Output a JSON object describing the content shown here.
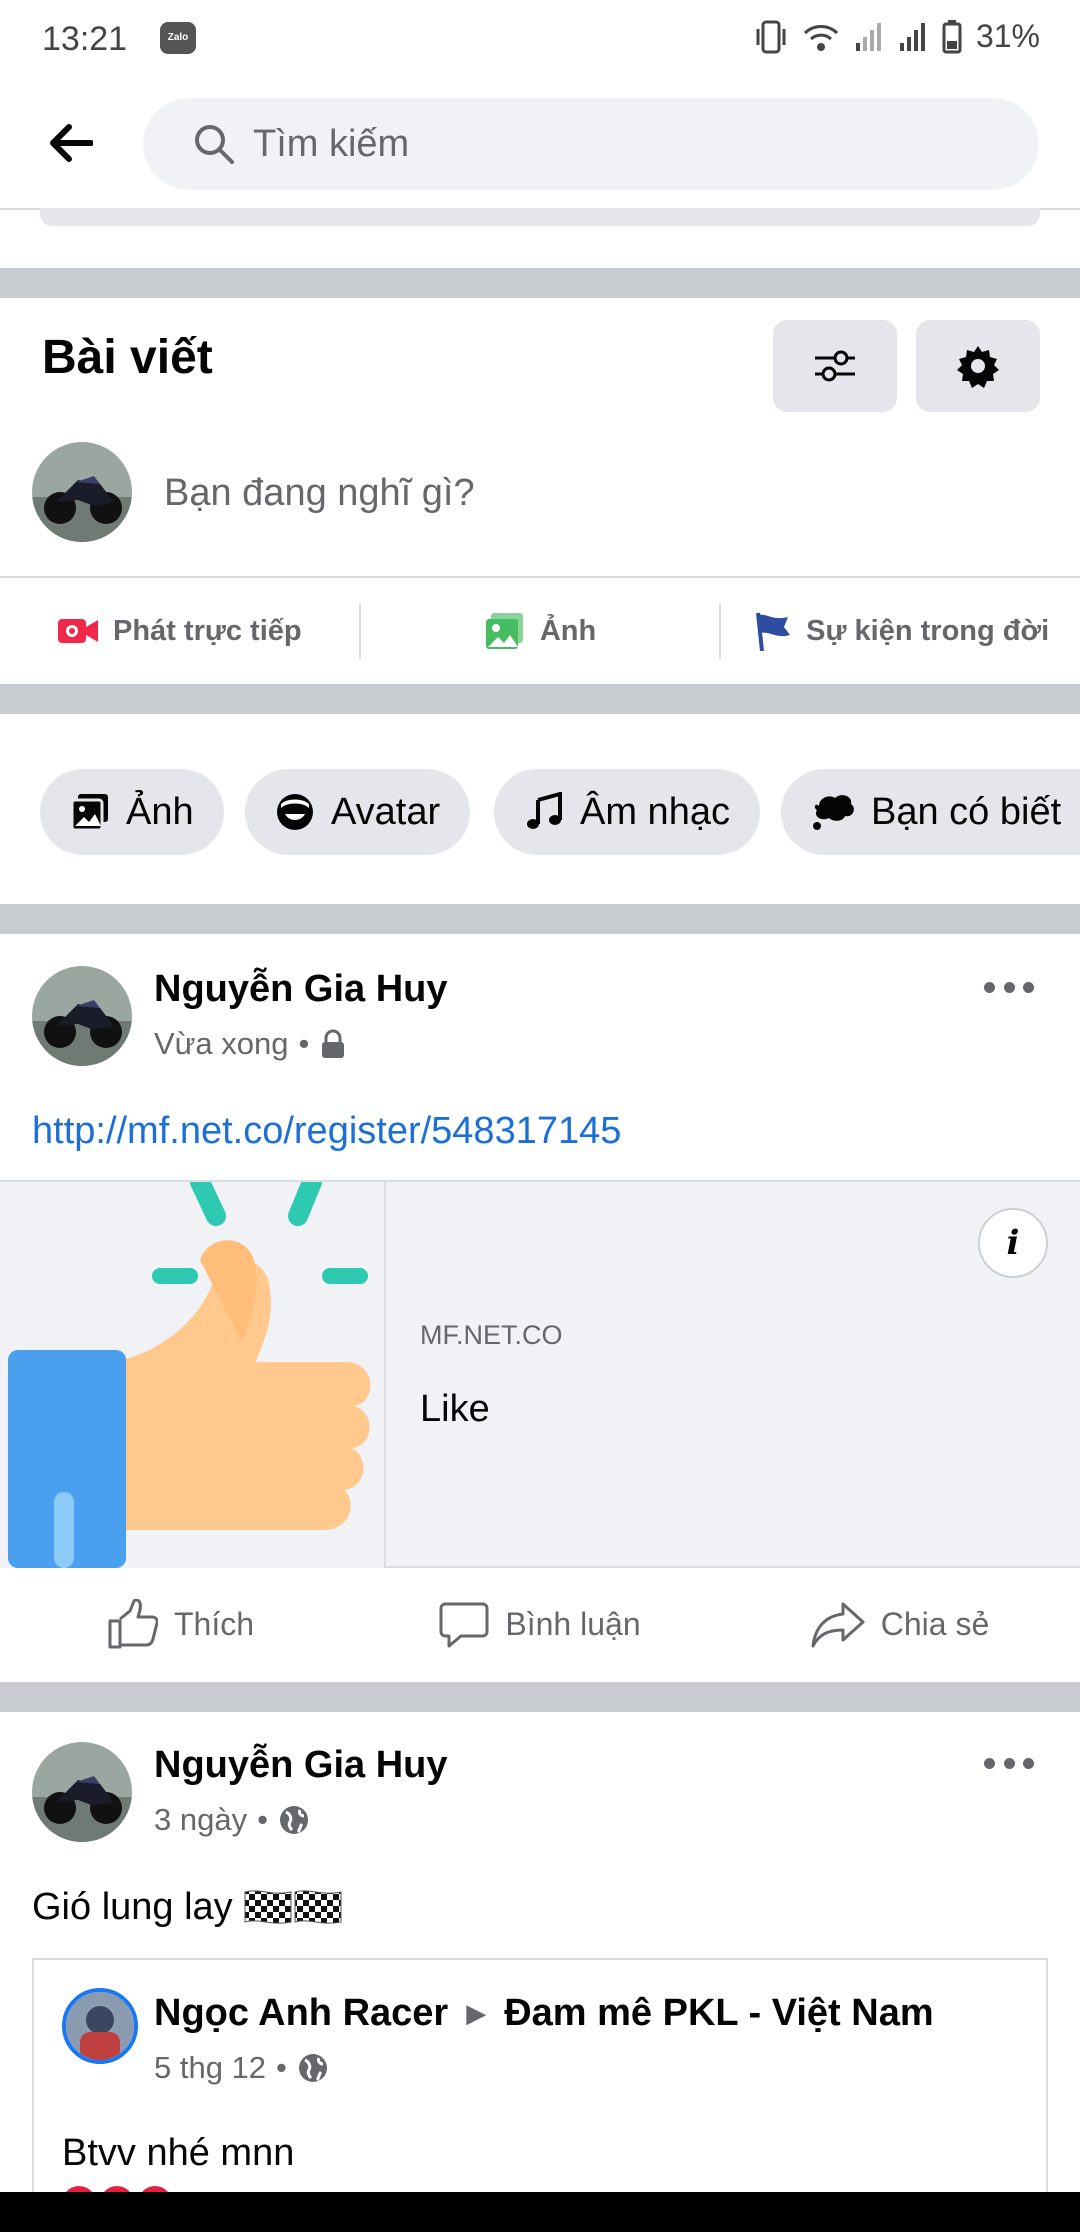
{
  "status_bar": {
    "time": "13:21",
    "notification_app": "Zalo",
    "battery": "31%"
  },
  "search": {
    "placeholder": "Tìm kiếm"
  },
  "posts_section": {
    "title": "Bài viết",
    "composer_placeholder": "Bạn đang nghĩ gì?",
    "actions": [
      {
        "label": "Phát trực tiếp",
        "icon": "live-video-icon",
        "color": "#f02849"
      },
      {
        "label": "Ảnh",
        "icon": "photo-icon",
        "color": "#45bd62"
      },
      {
        "label": "Sự kiện trong đời",
        "icon": "flag-icon",
        "color": "#2d4ea0"
      }
    ]
  },
  "chips": [
    {
      "label": "Ảnh",
      "icon": "photo-album-icon"
    },
    {
      "label": "Avatar",
      "icon": "avatar-icon"
    },
    {
      "label": "Âm nhạc",
      "icon": "music-note-icon"
    },
    {
      "label": "Bạn có biết",
      "icon": "speech-bubble-icon"
    }
  ],
  "post1": {
    "author": "Nguyễn Gia Huy",
    "time": "Vừa xong",
    "privacy_icon": "lock-icon",
    "link_text": "http://mf.net.co/register/548317145",
    "link_card": {
      "domain": "MF.NET.CO",
      "title": "Like",
      "info_label": "i"
    }
  },
  "reactions": {
    "like": "Thích",
    "comment": "Bình luận",
    "share": "Chia sẻ"
  },
  "post2": {
    "author": "Nguyễn Gia Huy",
    "time": "3 ngày",
    "privacy_icon": "globe-icon",
    "text": "Gió lung lay",
    "shared": {
      "author": "Ngọc Anh Racer",
      "arrow": "▶",
      "group": "Đam mê PKL - Việt Nam",
      "time": "5 thg 12",
      "text": "Btvv nhé mnn"
    }
  },
  "colors": {
    "link": "#1b6fd6",
    "secondary_text": "#65676b",
    "divider": "#c9ccd1",
    "accent_blue": "#1877f2"
  }
}
